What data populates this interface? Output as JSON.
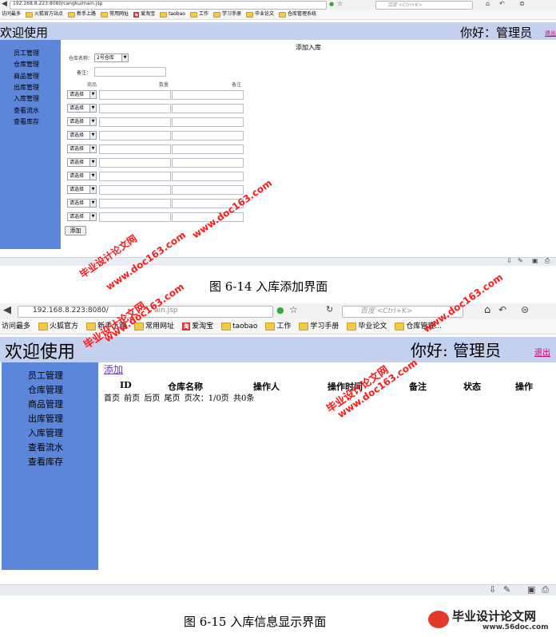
{
  "browser": {
    "url_1": "192.168.8.223:8080/cangku/main.jsp",
    "url_2_visible": "192.168.8.223:8080/",
    "url_2_tail": "ain.jsp",
    "search_placeholder": "百度 <Ctrl+K>",
    "bookmarks": [
      "访问最多",
      "火狐官方站点",
      "新手上路",
      "常用网址",
      "爱淘宝",
      "taobao",
      "工作",
      "学习手册",
      "毕业论文",
      "仓库管理系统"
    ],
    "bookmarks_2": [
      "访问最多",
      "火狐官方",
      "新手上路",
      "常用网址",
      "爱淘宝",
      "taobao",
      "工作",
      "学习手册",
      "毕业论文",
      "仓库管理..."
    ],
    "taobao_badge": "淘"
  },
  "app": {
    "welcome": "欢迎使用",
    "greeting": "你好：管理员",
    "greeting_2": "你好:  管理员",
    "logout": "退出",
    "menu": [
      "员工管理",
      "仓库管理",
      "商品管理",
      "出库管理",
      "入库管理",
      "查看流水",
      "查看库存"
    ]
  },
  "form": {
    "title": "添加入库",
    "warehouse_label": "仓库名称：",
    "warehouse_value": "2号仓库",
    "remark_label": "备注：",
    "col_goods": "商品",
    "col_qty": "数量",
    "col_note": "备注",
    "select_placeholder": "请选择",
    "row_count": 10,
    "add_button": "添加"
  },
  "list": {
    "add_link": "添加",
    "headers": [
      "ID",
      "仓库名称",
      "操作人",
      "操作时间",
      "备注",
      "状态",
      "操作"
    ],
    "pagination": "首页  前页  后页  尾页  页次：1/0页  共0条"
  },
  "captions": {
    "fig1": "图 6-14 入库添加界面",
    "fig2": "图 6-15 入库信息显示界面"
  },
  "watermark": {
    "line1": "毕业设计论文网",
    "line2": "www.doc163.com",
    "logo_title": "毕业设计论文网",
    "logo_url": "www.56doc.com"
  },
  "colors": {
    "header_bg": "#c3d0ee",
    "sidebar_bg": "#5b86d9",
    "link": "#6a3aa5",
    "watermark": "#ff1a1a",
    "logout": "#d0006f"
  }
}
